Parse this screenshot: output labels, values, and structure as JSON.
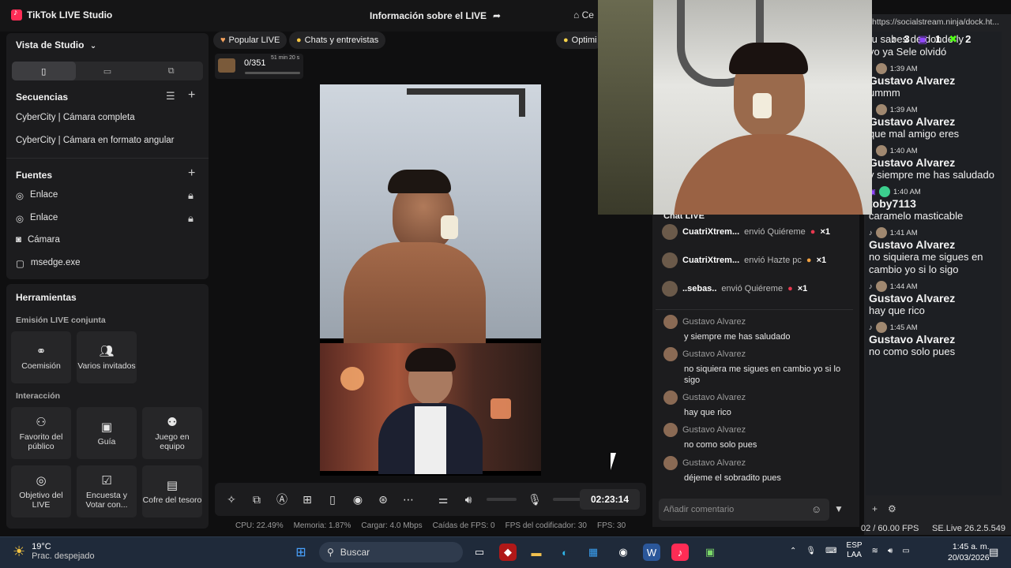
{
  "app": {
    "title": "TikTok LIVE Studio",
    "live_info": "Información sobre el LIVE",
    "home_label": "Ce"
  },
  "studio": {
    "view_label": "Vista de Studio"
  },
  "sequences": {
    "title": "Secuencias",
    "items": [
      "CyberCity | Cámara completa",
      "CyberCity | Cámara en formato angular"
    ]
  },
  "sources": {
    "title": "Fuentes",
    "items": [
      "Enlace",
      "Enlace",
      "Cámara",
      "msedge.exe"
    ]
  },
  "tools": {
    "title": "Herramientas",
    "joint_title": "Emisión LIVE conjunta",
    "joint": [
      "Coemisión",
      "Varios invitados"
    ],
    "interaction_title": "Interacción",
    "interaction": [
      "Favorito del público",
      "Guía",
      "Juego en equipo",
      "Objetivo del LIVE",
      "Encuesta y Votar con...",
      "Cofre del tesoro"
    ]
  },
  "chips": {
    "popular": "Popular LIVE",
    "chats": "Chats y entrevistas",
    "optimi": "Optimi"
  },
  "goal": {
    "count": "0/351",
    "time": "51 min 20 s",
    "progress": 0.0
  },
  "timer": "02:23:14",
  "stats": {
    "cpu": "CPU:  22.49%",
    "mem": "Memoria:  1.87%",
    "load": "Cargar:  4.0 Mbps",
    "drops": "Caídas de FPS:  0",
    "enc": "FPS del codificador:  30",
    "fps": "FPS:  30"
  },
  "chat": {
    "header": "Chat LIVE",
    "gifts": [
      {
        "user": "CuatriXtrem...",
        "text": "envió Quiéreme",
        "count": "×1"
      },
      {
        "user": "CuatriXtrem...",
        "text": "envió Hazte pc",
        "count": "×1"
      },
      {
        "user": "..sebas..",
        "text": "envió Quiéreme",
        "count": "×1"
      }
    ],
    "messages": [
      {
        "user": "Gustavo Alvarez",
        "text": "y siempre me has saludado"
      },
      {
        "user": "Gustavo Alvarez",
        "text": "no siquiera me sigues en cambio yo si lo sigo"
      },
      {
        "user": "Gustavo Alvarez",
        "text": "hay que rico"
      },
      {
        "user": "Gustavo Alvarez",
        "text": "no como solo pues"
      },
      {
        "user": "Gustavo Alvarez",
        "text": "déjeme el sobradito pues"
      }
    ],
    "placeholder": "Añadir comentario"
  },
  "browser": {
    "url": "https://socialstream.ninja/dock.ht...",
    "counts": [
      "3",
      "1",
      "2"
    ]
  },
  "ss_chat": {
    "top_lines": [
      "tu sabes de donde ly",
      "yo ya Sele olvidó"
    ],
    "messages": [
      {
        "time": "1:39 AM",
        "name": "Gustavo Alvarez",
        "text": "ummm"
      },
      {
        "time": "1:39 AM",
        "name": "Gustavo Alvarez",
        "text": "que mal amigo eres"
      },
      {
        "time": "1:40 AM",
        "name": "Gustavo Alvarez",
        "text": "y siempre me has saludado"
      },
      {
        "time": "1:40 AM",
        "name": "toby7113",
        "text": "caramelo masticable"
      },
      {
        "time": "1:41 AM",
        "name": "Gustavo Alvarez",
        "text": "no siquiera me sigues en cambio yo si lo sigo"
      },
      {
        "time": "1:44 AM",
        "name": "Gustavo Alvarez",
        "text": "hay que rico"
      },
      {
        "time": "1:45 AM",
        "name": "Gustavo Alvarez",
        "text": "no como solo pues"
      }
    ]
  },
  "obs": {
    "fps": "02 / 60.00 FPS",
    "version": "SE.Live 26.2.5.549"
  },
  "taskbar": {
    "temp": "19°C",
    "weather": "Prac. despejado",
    "search": "Buscar",
    "lang1": "ESP",
    "lang2": "LAA",
    "time": "1:45 a. m.",
    "date": "20/03/2026"
  }
}
